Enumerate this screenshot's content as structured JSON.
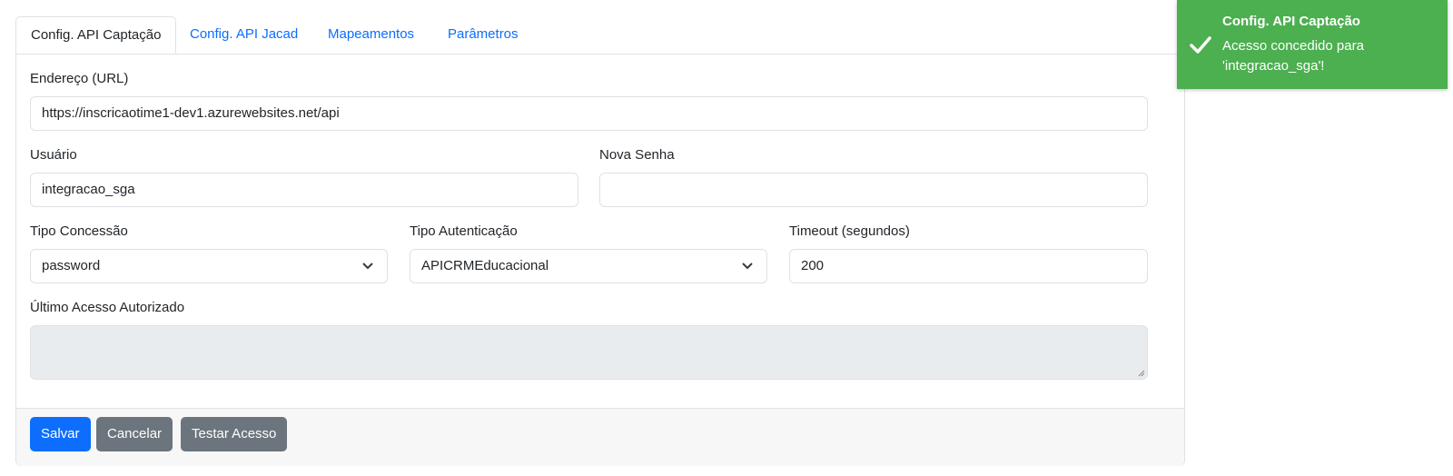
{
  "tabs": [
    {
      "label": "Config. API Captação",
      "active": true
    },
    {
      "label": "Config. API Jacad",
      "active": false
    },
    {
      "label": "Mapeamentos",
      "active": false
    },
    {
      "label": "Parâmetros",
      "active": false
    }
  ],
  "form": {
    "url_label": "Endereço (URL)",
    "url_value": "https://inscricaotime1-dev1.azurewebsites.net/api",
    "user_label": "Usuário",
    "user_value": "integracao_sga",
    "password_label": "Nova Senha",
    "password_value": "",
    "grant_label": "Tipo Concessão",
    "grant_value": "password",
    "auth_label": "Tipo Autenticação",
    "auth_value": "APICRMEducacional",
    "timeout_label": "Timeout (segundos)",
    "timeout_value": "200",
    "last_access_label": "Último Acesso Autorizado",
    "last_access_value": ""
  },
  "buttons": {
    "save": "Salvar",
    "cancel": "Cancelar",
    "test": "Testar Acesso"
  },
  "toast": {
    "title": "Config. API Captação",
    "message": "Acesso concedido para 'integracao_sga'!",
    "icon": "check-icon"
  },
  "colors": {
    "primary": "#0d6efd",
    "secondary": "#6c757d",
    "success": "#4caf50"
  }
}
